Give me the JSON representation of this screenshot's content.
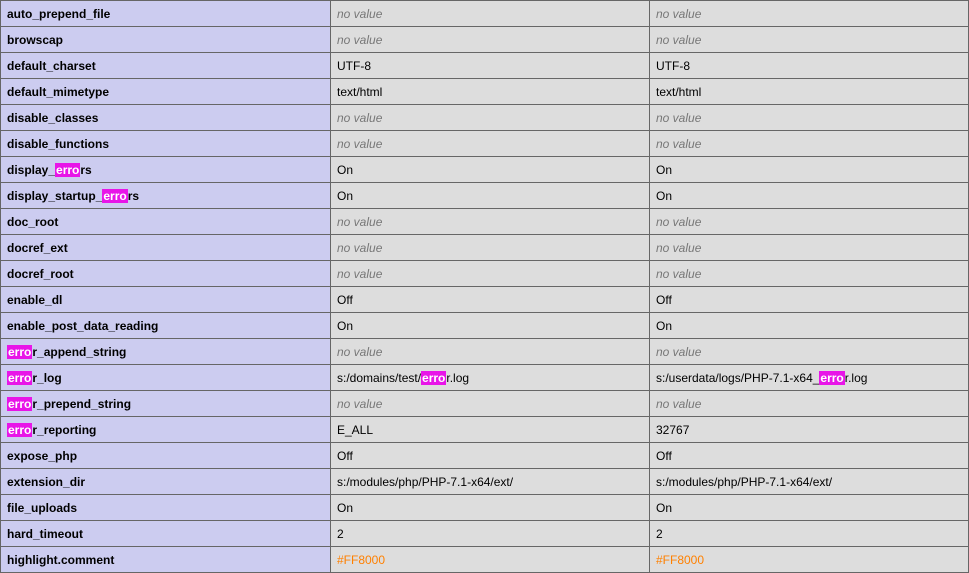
{
  "highlight_term": "erro",
  "no_value_text": "no value",
  "rows": [
    {
      "d": "auto_prepend_file",
      "lv": null,
      "mv": null
    },
    {
      "d": "browscap",
      "lv": null,
      "mv": null
    },
    {
      "d": "default_charset",
      "lv": "UTF-8",
      "mv": "UTF-8"
    },
    {
      "d": "default_mimetype",
      "lv": "text/html",
      "mv": "text/html"
    },
    {
      "d": "disable_classes",
      "lv": null,
      "mv": null
    },
    {
      "d": "disable_functions",
      "lv": null,
      "mv": null
    },
    {
      "d": "display_errors",
      "lv": "On",
      "mv": "On"
    },
    {
      "d": "display_startup_errors",
      "lv": "On",
      "mv": "On"
    },
    {
      "d": "doc_root",
      "lv": null,
      "mv": null
    },
    {
      "d": "docref_ext",
      "lv": null,
      "mv": null
    },
    {
      "d": "docref_root",
      "lv": null,
      "mv": null
    },
    {
      "d": "enable_dl",
      "lv": "Off",
      "mv": "Off"
    },
    {
      "d": "enable_post_data_reading",
      "lv": "On",
      "mv": "On"
    },
    {
      "d": "error_append_string",
      "lv": null,
      "mv": null
    },
    {
      "d": "error_log",
      "lv": "s:/domains/test/error.log",
      "mv": "s:/userdata/logs/PHP-7.1-x64_error.log"
    },
    {
      "d": "error_prepend_string",
      "lv": null,
      "mv": null
    },
    {
      "d": "error_reporting",
      "lv": "E_ALL",
      "mv": "32767"
    },
    {
      "d": "expose_php",
      "lv": "Off",
      "mv": "Off"
    },
    {
      "d": "extension_dir",
      "lv": "s:/modules/php/PHP-7.1-x64/ext/",
      "mv": "s:/modules/php/PHP-7.1-x64/ext/"
    },
    {
      "d": "file_uploads",
      "lv": "On",
      "mv": "On"
    },
    {
      "d": "hard_timeout",
      "lv": "2",
      "mv": "2"
    },
    {
      "d": "highlight.comment",
      "lv": "#FF8000",
      "mv": "#FF8000",
      "color": true
    }
  ]
}
